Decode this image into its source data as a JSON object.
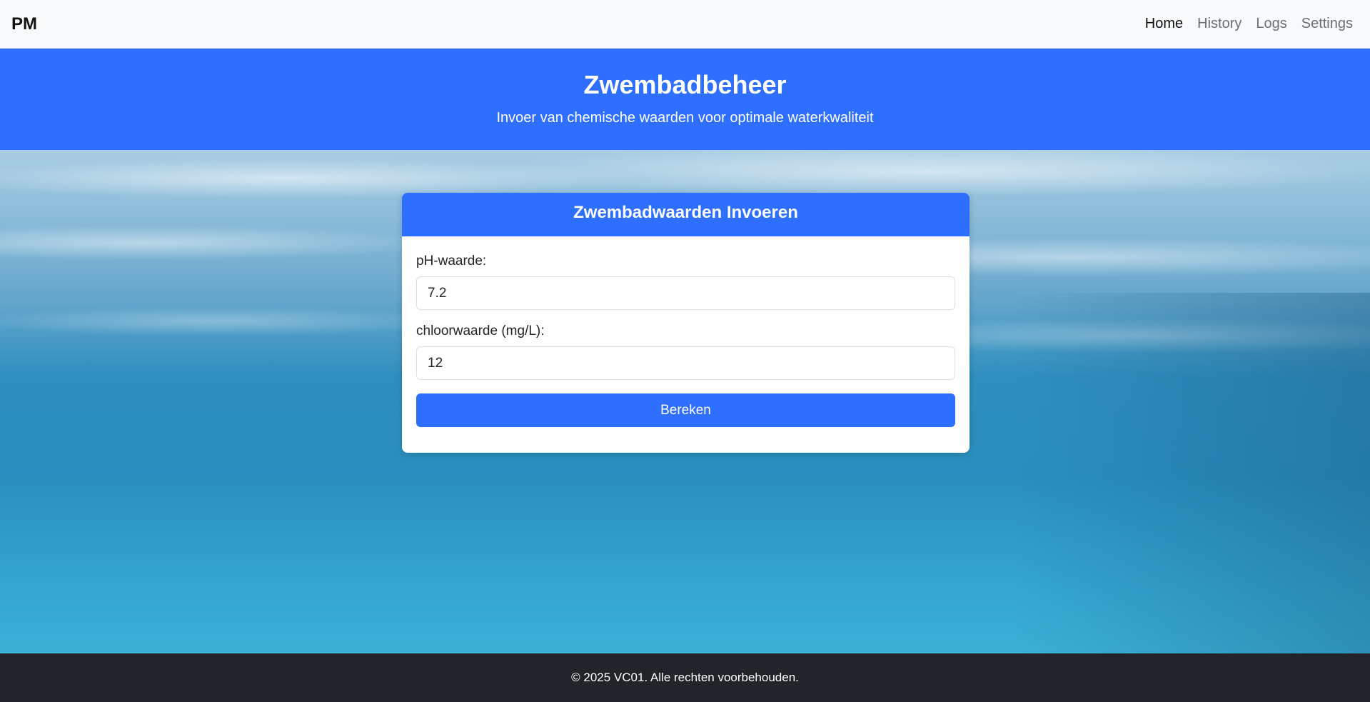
{
  "navbar": {
    "brand": "PM",
    "links": [
      {
        "label": "Home",
        "active": true
      },
      {
        "label": "History",
        "active": false
      },
      {
        "label": "Logs",
        "active": false
      },
      {
        "label": "Settings",
        "active": false
      }
    ]
  },
  "hero": {
    "title": "Zwembadbeheer",
    "subtitle": "Invoer van chemische waarden voor optimale waterkwaliteit"
  },
  "form": {
    "header": "Zwembadwaarden Invoeren",
    "ph": {
      "label": "pH-waarde:",
      "value": "7.2"
    },
    "chlorine": {
      "label": "chloorwaarde (mg/L):",
      "value": "12"
    },
    "submit_label": "Bereken"
  },
  "footer": {
    "text": "© 2025 VC01. Alle rechten voorbehouden."
  },
  "colors": {
    "primary": "#2f6fff",
    "navbar_bg": "#f8f9fa",
    "footer_bg": "#212529"
  }
}
